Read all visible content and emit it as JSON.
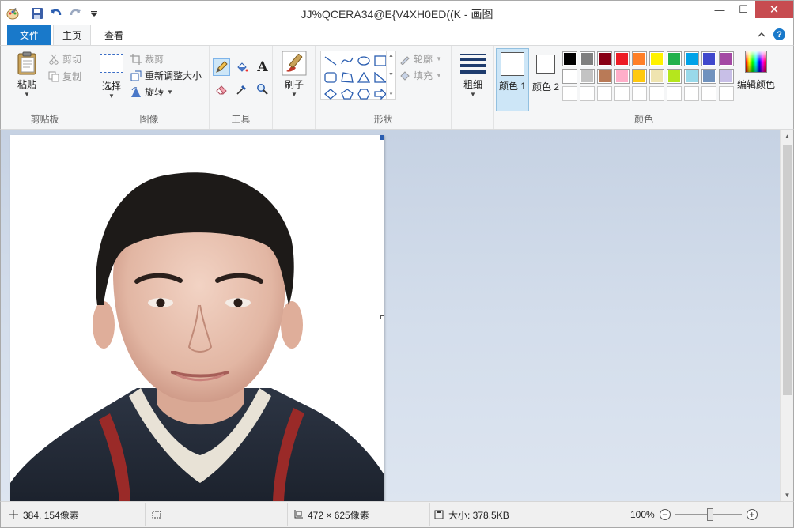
{
  "window": {
    "title": "JJ%QCERA34@E{V4XH0ED((K - 画图"
  },
  "tabs": {
    "file": "文件",
    "home": "主页",
    "view": "查看"
  },
  "ribbon": {
    "clipboard": {
      "label": "剪贴板",
      "paste": "粘贴",
      "cut": "剪切",
      "copy": "复制"
    },
    "image": {
      "label": "图像",
      "select": "选择",
      "crop": "裁剪",
      "resize": "重新调整大小",
      "rotate": "旋转"
    },
    "tools": {
      "label": "工具"
    },
    "brushes": {
      "label": "刷子"
    },
    "shapes": {
      "label": "形状",
      "outline": "轮廓",
      "fill": "填充"
    },
    "size": {
      "label": "粗细"
    },
    "colors": {
      "label": "颜色",
      "color1": "颜色 1",
      "color2": "颜色 2",
      "edit": "编辑颜色",
      "palette_row1": [
        "#000000",
        "#7f7f7f",
        "#880015",
        "#ed1c24",
        "#ff7f27",
        "#fff200",
        "#22b14c",
        "#00a2e8",
        "#3f48cc",
        "#a349a4"
      ],
      "palette_row2": [
        "#ffffff",
        "#c3c3c3",
        "#b97a57",
        "#ffaec9",
        "#ffc90e",
        "#efe4b0",
        "#b5e61d",
        "#99d9ea",
        "#7092be",
        "#c8bfe7"
      ]
    }
  },
  "statusbar": {
    "cursor_pos": "384, 154像素",
    "image_size": "472 × 625像素",
    "file_size": "大小: 378.5KB",
    "zoom": "100%"
  }
}
